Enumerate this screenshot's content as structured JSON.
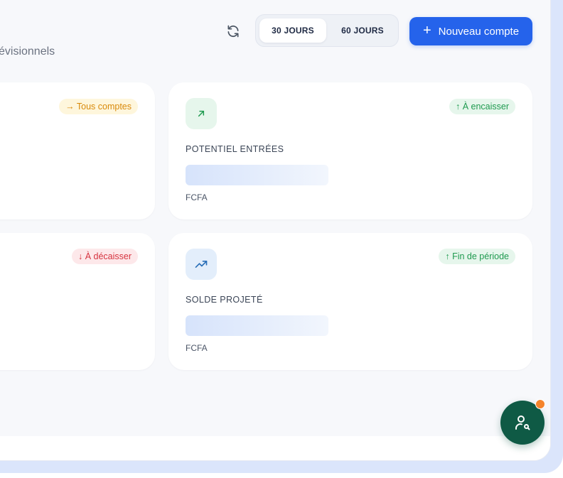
{
  "header": {
    "subtitle_fragment": "évisionnels",
    "period_options": [
      "30 JOURS",
      "60 JOURS"
    ],
    "selected_period": "30 JOURS",
    "new_account_label": "Nouveau compte"
  },
  "cards": [
    {
      "badge": "→ Tous comptes",
      "badge_tone": "orange"
    },
    {
      "label": "POTENTIEL ENTRÉES",
      "badge": "↑ À encaisser",
      "badge_tone": "green",
      "unit": "FCFA",
      "icon": "arrow-up-right-icon"
    },
    {
      "badge": "↓ À décaisser",
      "badge_tone": "red"
    },
    {
      "label": "SOLDE PROJETÉ",
      "badge": "↑ Fin de période",
      "badge_tone": "green",
      "unit": "FCFA",
      "icon": "trending-up-icon"
    }
  ],
  "colors": {
    "primary": "#2563eb",
    "fab": "#0f5a45",
    "notification": "#f5842b"
  },
  "icons": {
    "refresh": "refresh-icon",
    "fab": "user-search-icon"
  }
}
